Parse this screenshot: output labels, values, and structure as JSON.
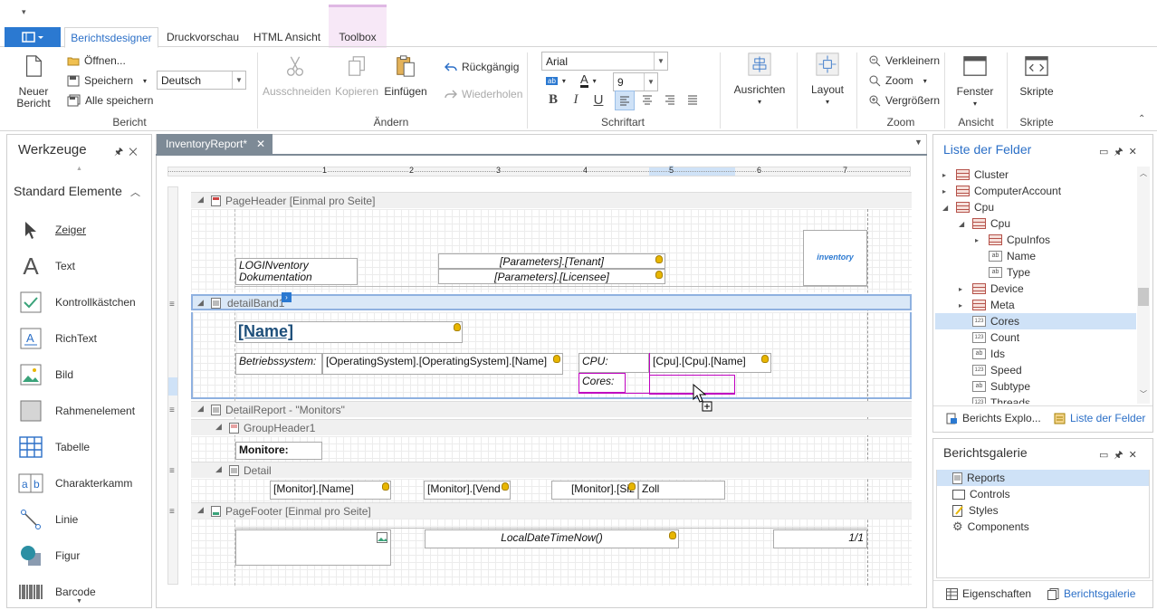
{
  "ribbon_tabs": [
    "Berichtsdesigner",
    "Druckvorschau",
    "HTML Ansicht",
    "Toolbox"
  ],
  "ribbon": {
    "bericht": {
      "new_label": "Neuer Bericht",
      "open": "Öffnen...",
      "save": "Speichern",
      "save_all": "Alle speichern",
      "language": "Deutsch",
      "group": "Bericht"
    },
    "aendern": {
      "cut": "Ausschneiden",
      "copy": "Kopieren",
      "paste": "Einfügen",
      "undo": "Rückgängig",
      "redo": "Wiederholen",
      "group": "Ändern"
    },
    "schriftart": {
      "font": "Arial",
      "size": "9",
      "group": "Schriftart",
      "bold": "B",
      "italic": "I",
      "underline": "U"
    },
    "ausrichten": {
      "label": "Ausrichten"
    },
    "layout": {
      "label": "Layout"
    },
    "zoom": {
      "out": "Verkleinern",
      "zoom": "Zoom",
      "in": "Vergrößern",
      "group": "Zoom"
    },
    "ansicht": {
      "window": "Fenster",
      "group": "Ansicht"
    },
    "skripte": {
      "label": "Skripte",
      "group": "Skripte"
    }
  },
  "toolbox": {
    "title": "Werkzeuge",
    "section": "Standard Elemente",
    "items": [
      "Zeiger",
      "Text",
      "Kontrollkästchen",
      "RichText",
      "Bild",
      "Rahmenelement",
      "Tabelle",
      "Charakterkamm",
      "Linie",
      "Figur",
      "Barcode"
    ]
  },
  "document": {
    "tab": "InventoryReport*",
    "ruler": [
      "1",
      "2",
      "3",
      "4",
      "5",
      "6",
      "7"
    ],
    "bands": {
      "page_header": "PageHeader [Einmal pro Seite]",
      "detail_band": "detailBand1",
      "detail_report": "DetailReport - \"Monitors\"",
      "group_header": "GroupHeader1",
      "detail": "Detail",
      "page_footer": "PageFooter [Einmal pro Seite]"
    },
    "fields": {
      "logo_text": "LOGINventory Dokumentation",
      "tenant": "[Parameters].[Tenant]",
      "licensee": "[Parameters].[Licensee]",
      "logo_img": "inventory",
      "name": "[Name]",
      "os_label": "Betriebssystem:",
      "os_value": "[OperatingSystem].[OperatingSystem].[Name]",
      "cpu_label": "CPU:",
      "cpu_value": "[Cpu].[Cpu].[Name]",
      "cores_label": "Cores:",
      "monitors": "Monitore:",
      "mon_name": "[Monitor].[Name]",
      "mon_vendor": "[Monitor].[Vend",
      "mon_size": "[Monitor].[Siz",
      "zoll": "Zoll",
      "datetime": "LocalDateTimeNow()",
      "page": "1/1"
    }
  },
  "field_list": {
    "title": "Liste der Felder",
    "items": [
      {
        "label": "Cluster",
        "type": "table",
        "indent": 1,
        "expander": "▸"
      },
      {
        "label": "ComputerAccount",
        "type": "table",
        "indent": 1,
        "expander": "▸"
      },
      {
        "label": "Cpu",
        "type": "table",
        "indent": 1,
        "expander": "◢"
      },
      {
        "label": "Cpu",
        "type": "table",
        "indent": 2,
        "expander": "◢"
      },
      {
        "label": "CpuInfos",
        "type": "table",
        "indent": 3,
        "expander": "▸"
      },
      {
        "label": "Name",
        "type": "ab",
        "indent": 3,
        "expander": ""
      },
      {
        "label": "Type",
        "type": "ab",
        "indent": 3,
        "expander": ""
      },
      {
        "label": "Device",
        "type": "table",
        "indent": 2,
        "expander": "▸"
      },
      {
        "label": "Meta",
        "type": "table",
        "indent": 2,
        "expander": "▸"
      },
      {
        "label": "Cores",
        "type": "123",
        "indent": 2,
        "expander": ""
      },
      {
        "label": "Count",
        "type": "123",
        "indent": 2,
        "expander": ""
      },
      {
        "label": "Ids",
        "type": "ab",
        "indent": 2,
        "expander": ""
      },
      {
        "label": "Speed",
        "type": "123",
        "indent": 2,
        "expander": ""
      },
      {
        "label": "Subtype",
        "type": "ab",
        "indent": 2,
        "expander": ""
      },
      {
        "label": "Threads",
        "type": "123",
        "indent": 2,
        "expander": ""
      }
    ],
    "bottom_tabs": [
      "Berichts Explo...",
      "Liste der Felder"
    ]
  },
  "gallery": {
    "title": "Berichtsgalerie",
    "items": [
      "Reports",
      "Controls",
      "Styles",
      "Components"
    ],
    "bottom_tabs": [
      "Eigenschaften",
      "Berichtsgalerie"
    ]
  },
  "colors": {
    "accent": "#2b79d1",
    "selection": "#cfe2f7",
    "magenta": "#c000c0"
  }
}
